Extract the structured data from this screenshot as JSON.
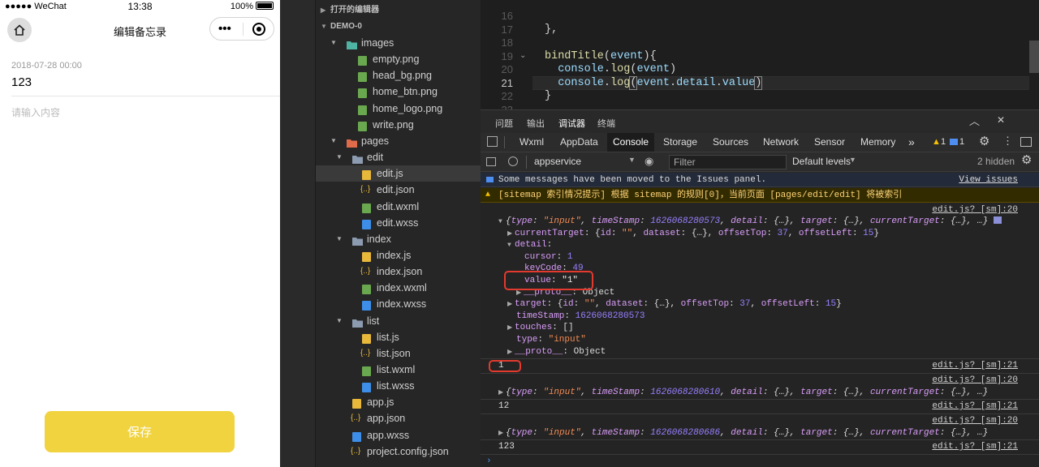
{
  "phone": {
    "status": {
      "carrier": "●●●●● WeChat",
      "time": "13:38",
      "battery": "100%"
    },
    "nav": {
      "title": "编辑备忘录",
      "dots": "•••"
    },
    "memo": {
      "time": "2018-07-28 00:00",
      "title": "123",
      "content_placeholder": "请输入内容"
    },
    "save_label": "保存"
  },
  "explorer": {
    "open_editors": "打开的编辑器",
    "project": "DEMO-0",
    "tree": [
      {
        "label": "images",
        "type": "folder-img",
        "depth": 1,
        "open": true
      },
      {
        "label": "empty.png",
        "type": "png",
        "depth": 2
      },
      {
        "label": "head_bg.png",
        "type": "png",
        "depth": 2
      },
      {
        "label": "home_btn.png",
        "type": "png",
        "depth": 2
      },
      {
        "label": "home_logo.png",
        "type": "png",
        "depth": 2
      },
      {
        "label": "write.png",
        "type": "png",
        "depth": 2
      },
      {
        "label": "pages",
        "type": "folder-pages",
        "depth": 1,
        "open": true
      },
      {
        "label": "edit",
        "type": "folder",
        "depth": 2,
        "open": true
      },
      {
        "label": "edit.js",
        "type": "js",
        "depth": 3,
        "selected": true
      },
      {
        "label": "edit.json",
        "type": "json",
        "depth": 3
      },
      {
        "label": "edit.wxml",
        "type": "wxml",
        "depth": 3
      },
      {
        "label": "edit.wxss",
        "type": "wxss",
        "depth": 3
      },
      {
        "label": "index",
        "type": "folder",
        "depth": 2,
        "open": true
      },
      {
        "label": "index.js",
        "type": "js",
        "depth": 3
      },
      {
        "label": "index.json",
        "type": "json",
        "depth": 3
      },
      {
        "label": "index.wxml",
        "type": "wxml",
        "depth": 3
      },
      {
        "label": "index.wxss",
        "type": "wxss",
        "depth": 3
      },
      {
        "label": "list",
        "type": "folder",
        "depth": 2,
        "open": true
      },
      {
        "label": "list.js",
        "type": "js",
        "depth": 3
      },
      {
        "label": "list.json",
        "type": "json",
        "depth": 3
      },
      {
        "label": "list.wxml",
        "type": "wxml",
        "depth": 3
      },
      {
        "label": "list.wxss",
        "type": "wxss",
        "depth": 3
      },
      {
        "label": "app.js",
        "type": "js",
        "depth": 1
      },
      {
        "label": "app.json",
        "type": "json",
        "depth": 1
      },
      {
        "label": "app.wxss",
        "type": "wxss",
        "depth": 1
      },
      {
        "label": "project.config.json",
        "type": "json",
        "depth": 1
      }
    ]
  },
  "editor": {
    "line_numbers": [
      "16",
      "17",
      "18",
      "19",
      "20",
      "21",
      "22"
    ],
    "current_line": "21"
  },
  "devtools": {
    "panel_tabs": [
      "问题",
      "输出",
      "调试器",
      "终端"
    ],
    "active_panel": "调试器",
    "tabs": [
      "Wxml",
      "AppData",
      "Console",
      "Storage",
      "Sources",
      "Network",
      "Sensor",
      "Memory"
    ],
    "active_tab": "Console",
    "more": "»",
    "warn_count": "1",
    "info_count": "1",
    "context": "appservice",
    "filter_placeholder": "Filter",
    "levels": "Default levels",
    "hidden": "2 hidden",
    "info_msg": "Some messages have been moved to the Issues panel.",
    "view_issues": "View issues",
    "warn_msg": "[sitemap 索引情况提示] 根据 sitemap 的规则[0]，当前页面 [pages/edit/edit] 将被索引",
    "src20": "edit.js? [sm]:20",
    "src21": "edit.js? [sm]:21",
    "obj1": {
      "ts": "1626068280573",
      "ct_prop": "currentTarget",
      "offsetTop": "37",
      "offsetLeft": "15",
      "cursor": "1",
      "keyCode": "49",
      "value": "\"1\"",
      "object": "Object"
    },
    "out1": "1",
    "ts2": "1626068280610",
    "out2": "12",
    "ts3": "1626068280686",
    "out3": "123"
  }
}
